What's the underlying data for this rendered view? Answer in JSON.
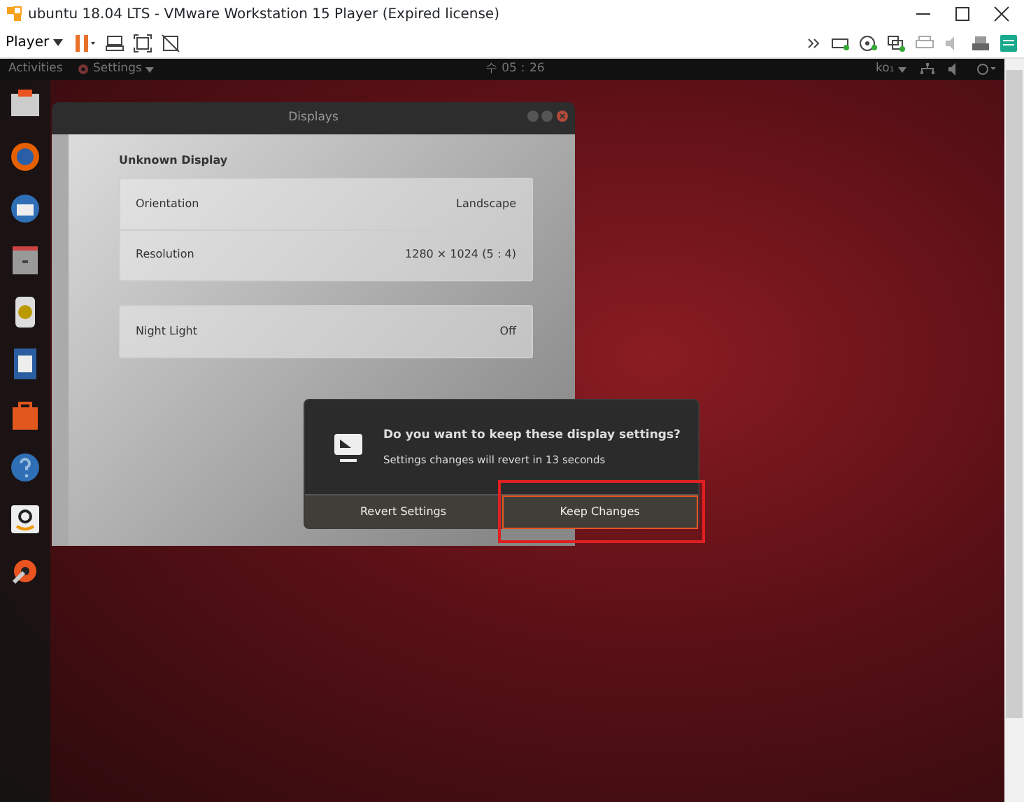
{
  "window": {
    "title": "ubuntu 18.04 LTS - VMware Workstation 15 Player (Expired license)"
  },
  "toolbar": {
    "player_menu": "Player"
  },
  "top_panel": {
    "activities": "Activities",
    "app_menu": "Settings",
    "clock": "수 05：26",
    "input_method": "ko₁"
  },
  "settings_window": {
    "title": "Displays",
    "section": "Unknown Display",
    "groups": [
      [
        {
          "label": "Orientation",
          "value": "Landscape"
        },
        {
          "label": "Resolution",
          "value": "1280 × 1024 (5：4)"
        }
      ],
      [
        {
          "label": "Night Light",
          "value": "Off"
        }
      ]
    ]
  },
  "dialog": {
    "title": "Do you want to keep these display settings?",
    "message": "Settings changes will revert in 13 seconds",
    "buttons": [
      {
        "label": "Revert Settings",
        "focused": false,
        "highlighted": false
      },
      {
        "label": "Keep Changes",
        "focused": true,
        "highlighted": true
      }
    ]
  }
}
